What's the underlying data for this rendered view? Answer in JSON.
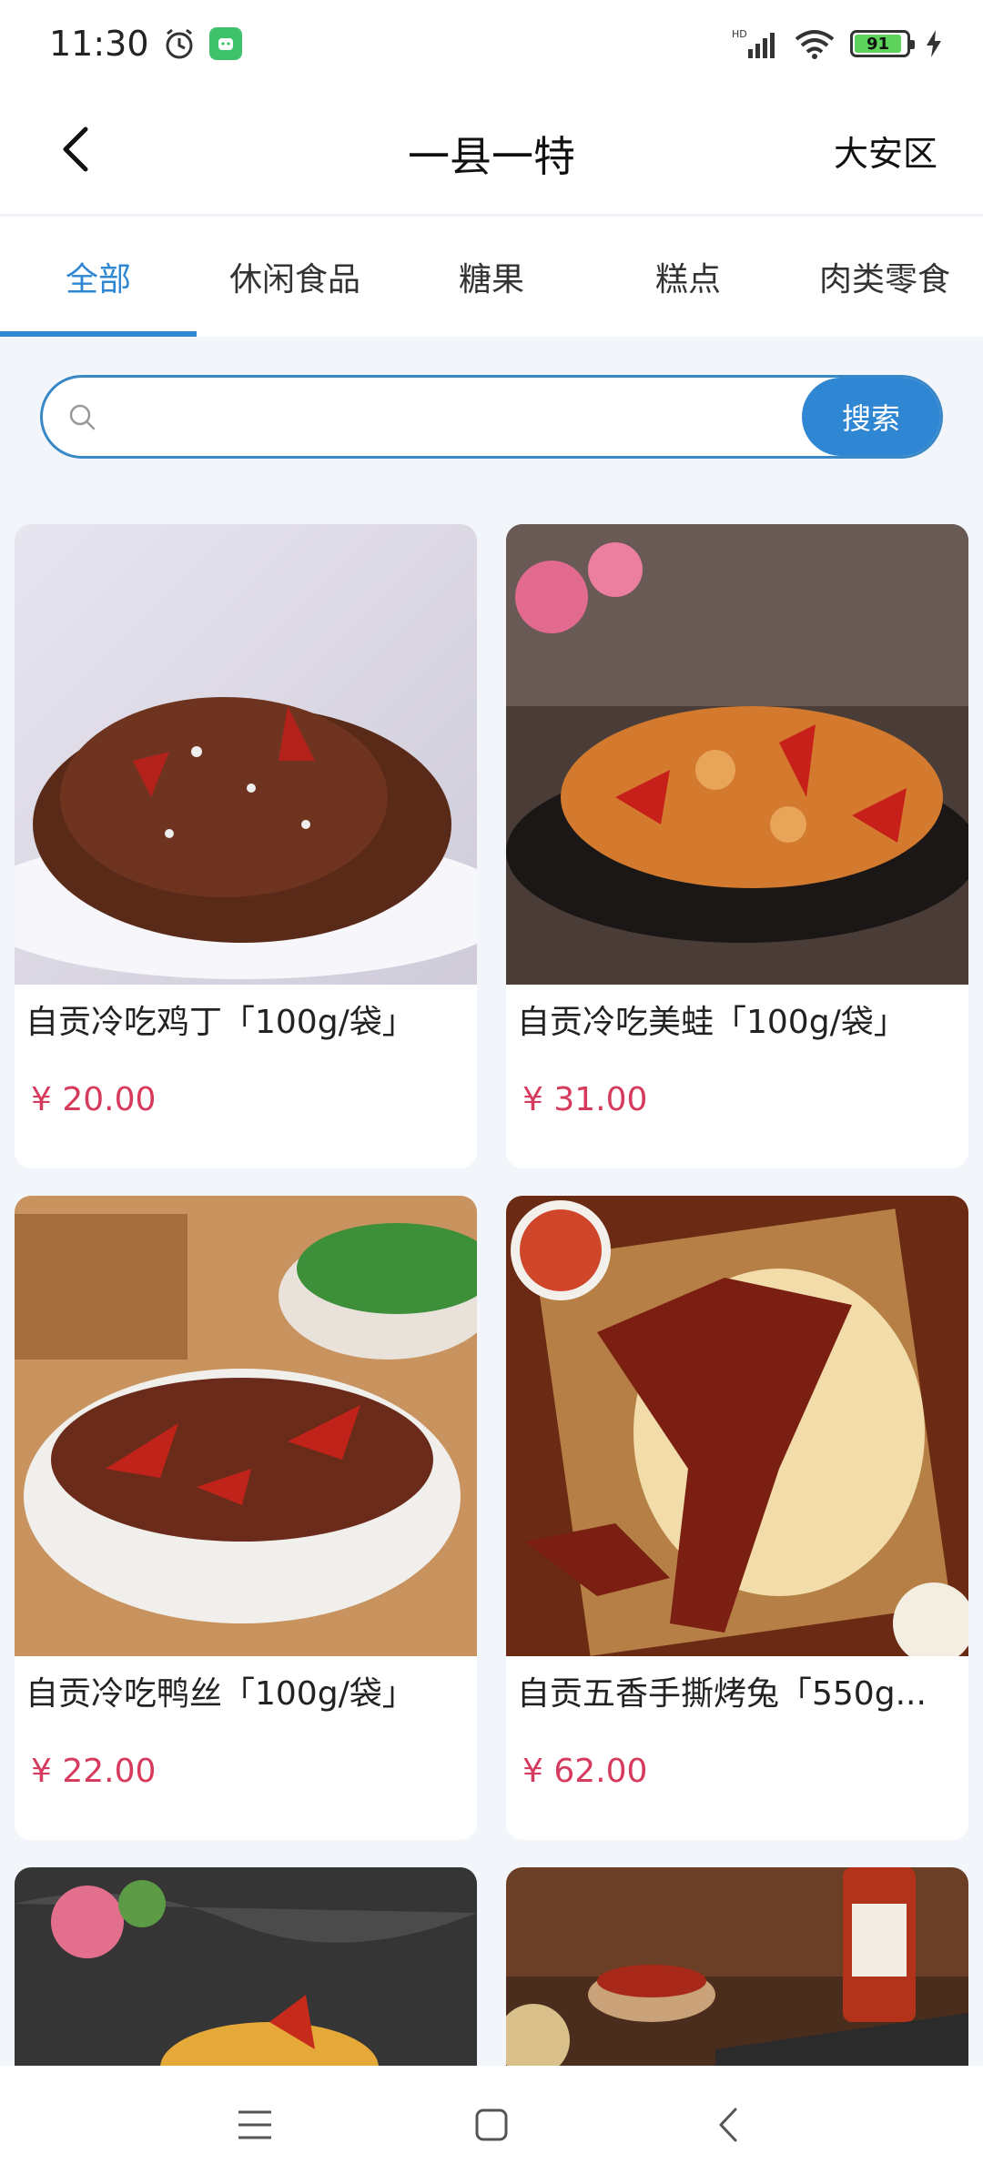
{
  "status": {
    "time": "11:30",
    "battery": "91",
    "network_label": "HD"
  },
  "header": {
    "title": "一县一特",
    "region": "大安区"
  },
  "tabs": [
    {
      "label": "全部"
    },
    {
      "label": "休闲食品"
    },
    {
      "label": "糖果"
    },
    {
      "label": "糕点"
    },
    {
      "label": "肉类零食"
    }
  ],
  "search": {
    "placeholder": "",
    "button_label": "搜索"
  },
  "products": [
    {
      "title": "自贡冷吃鸡丁「100g/袋」",
      "price": "¥ 20.00"
    },
    {
      "title": "自贡冷吃美蛙「100g/袋」",
      "price": "¥ 31.00"
    },
    {
      "title": "自贡冷吃鸭丝「100g/袋」",
      "price": "¥ 22.00"
    },
    {
      "title": "自贡五香手撕烤兔「550g...",
      "price": "¥ 62.00"
    }
  ],
  "colors": {
    "accent": "#2f86d3",
    "price": "#d63a5d"
  }
}
